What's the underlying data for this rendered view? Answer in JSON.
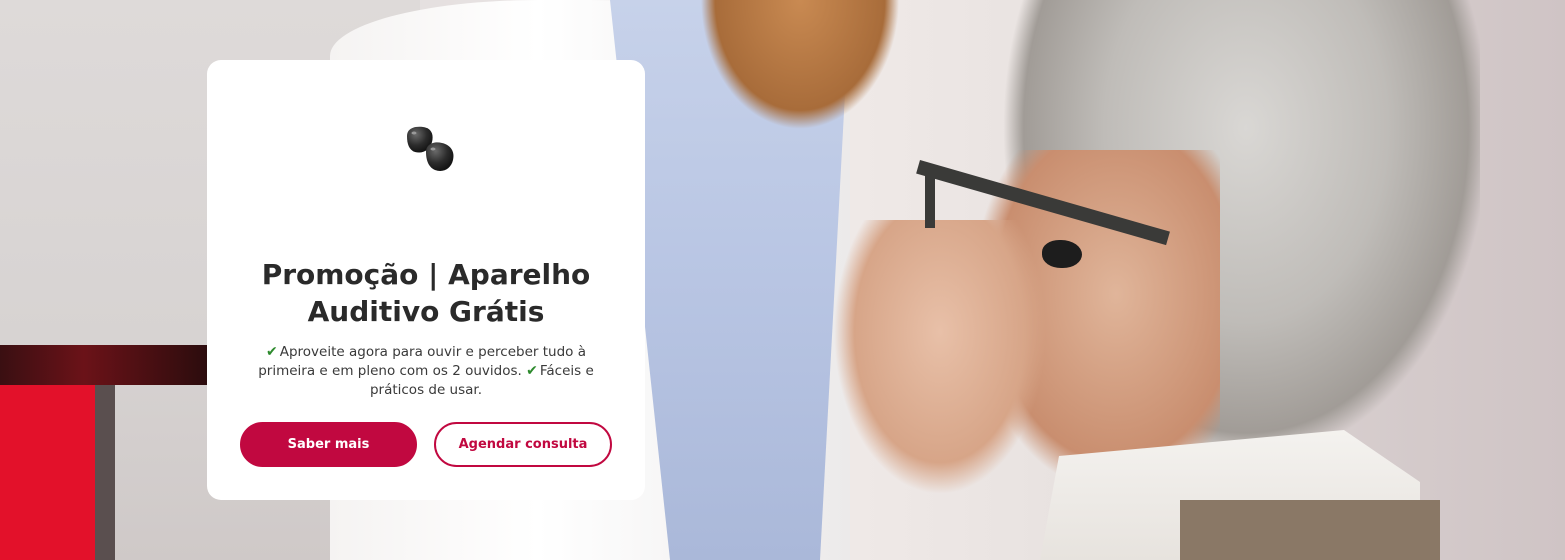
{
  "promo": {
    "title": "Promoção | Aparelho Auditivo Grátis",
    "description_part1": "Aproveite agora para ouvir e perceber tudo à primeira e em pleno com os 2 ouvidos.",
    "description_part2": "Fáceis e práticos de usar.",
    "check_icon": "✔",
    "primary_button": "Saber mais",
    "secondary_button": "Agendar consulta"
  },
  "brand_colors": {
    "accent": "#c10840",
    "check": "#2d8a2d",
    "text": "#2a2a2a"
  },
  "icons": {
    "product_image": "hearing-aid-pair-icon",
    "check": "checkmark-icon"
  }
}
